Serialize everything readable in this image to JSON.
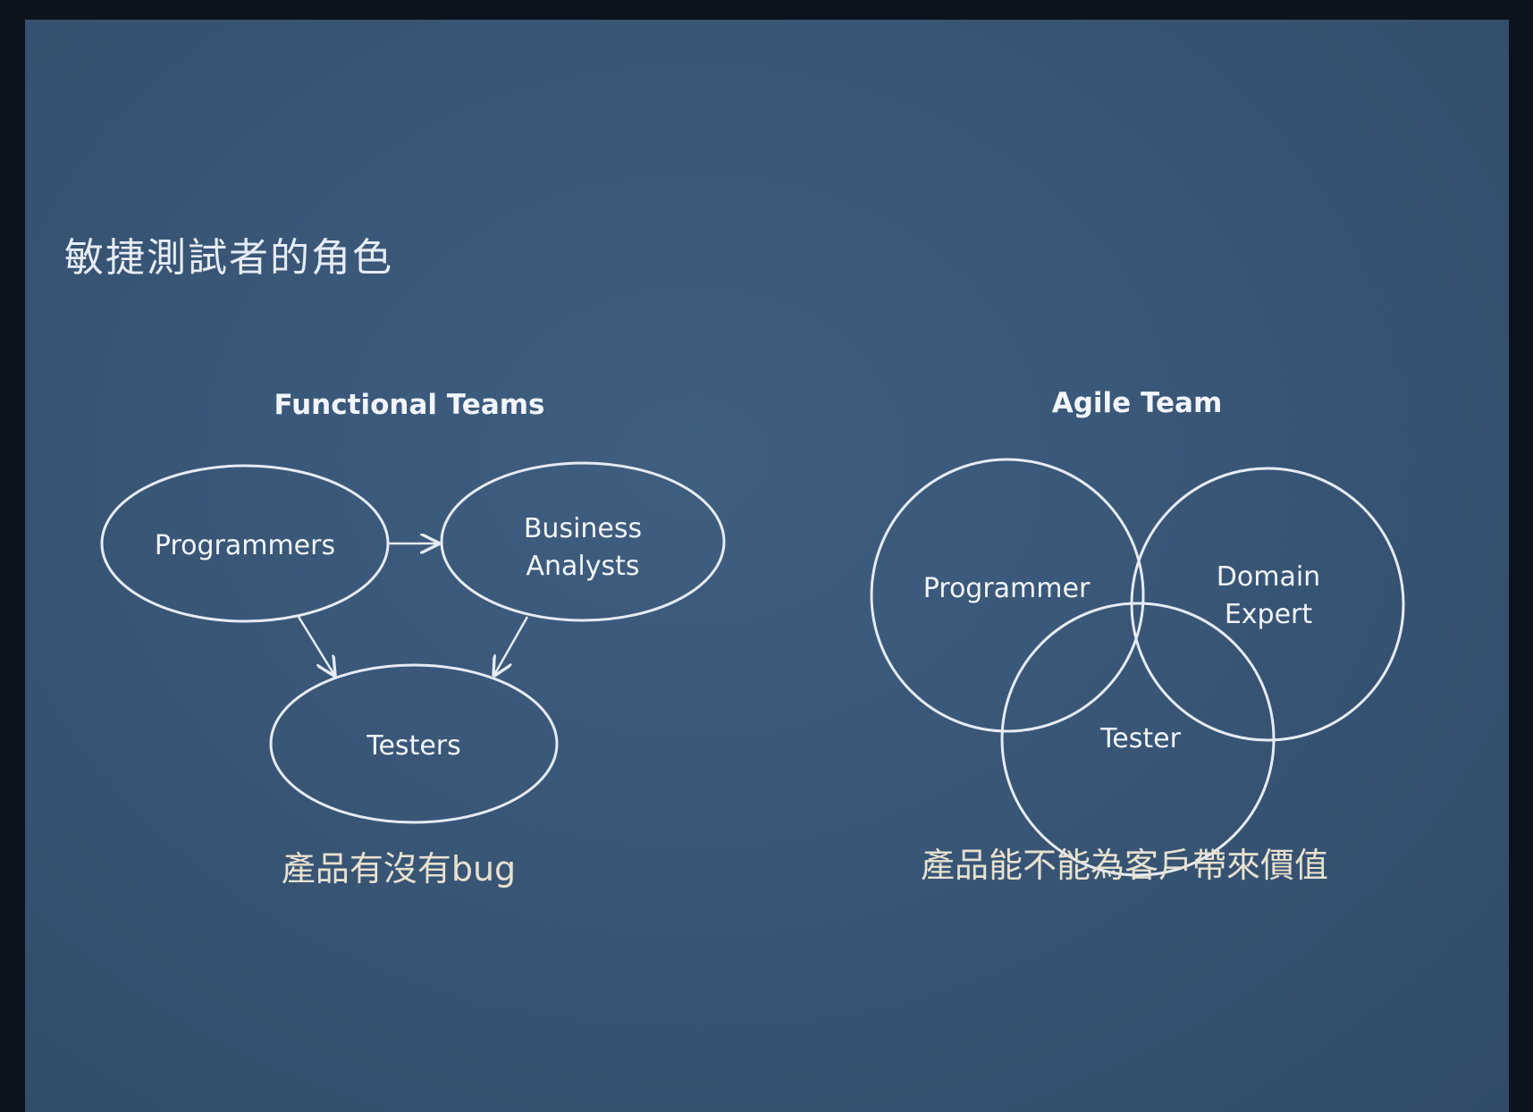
{
  "slide": {
    "title": "敏捷測試者的角色"
  },
  "functional": {
    "heading": "Functional Teams",
    "nodes": {
      "programmers": "Programmers",
      "business_line1": "Business",
      "business_line2": "Analysts",
      "testers": "Testers"
    },
    "caption": "產品有沒有bug"
  },
  "agile": {
    "heading": "Agile Team",
    "nodes": {
      "programmer": "Programmer",
      "domain_line1": "Domain",
      "domain_line2": "Expert",
      "tester": "Tester"
    },
    "caption": "產品能不能為客戶帶來價值"
  },
  "colors": {
    "background": "#395677",
    "highlight_fill": "#6a63c8",
    "outline": "#e6ebf4",
    "text": "#f2f5fb",
    "caption": "#e7e1cf"
  }
}
